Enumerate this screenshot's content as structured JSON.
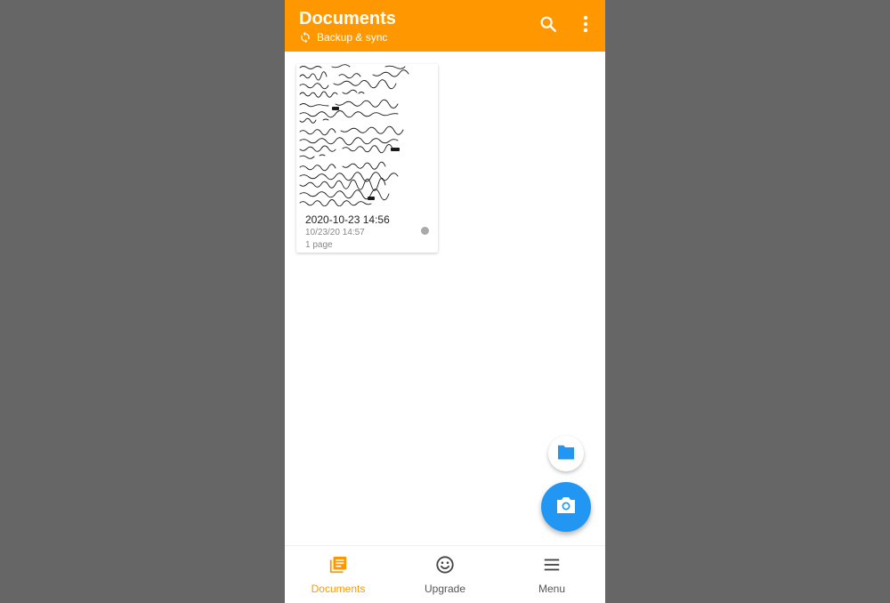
{
  "appbar": {
    "title": "Documents",
    "sync_label": "Backup & sync",
    "color": "#ff9800"
  },
  "documents": [
    {
      "title": "2020-10-23 14:56",
      "date": "10/23/20 14:57",
      "pages": "1 page",
      "sync_status_color": "#aaaaaa"
    }
  ],
  "fab": {
    "folder_icon": "folder-icon",
    "camera_icon": "camera-icon",
    "camera_color": "#2196f3"
  },
  "bottom_nav": {
    "items": [
      {
        "label": "Documents",
        "icon": "documents-icon",
        "active": true
      },
      {
        "label": "Upgrade",
        "icon": "smiley-icon",
        "active": false
      },
      {
        "label": "Menu",
        "icon": "menu-icon",
        "active": false
      }
    ]
  }
}
